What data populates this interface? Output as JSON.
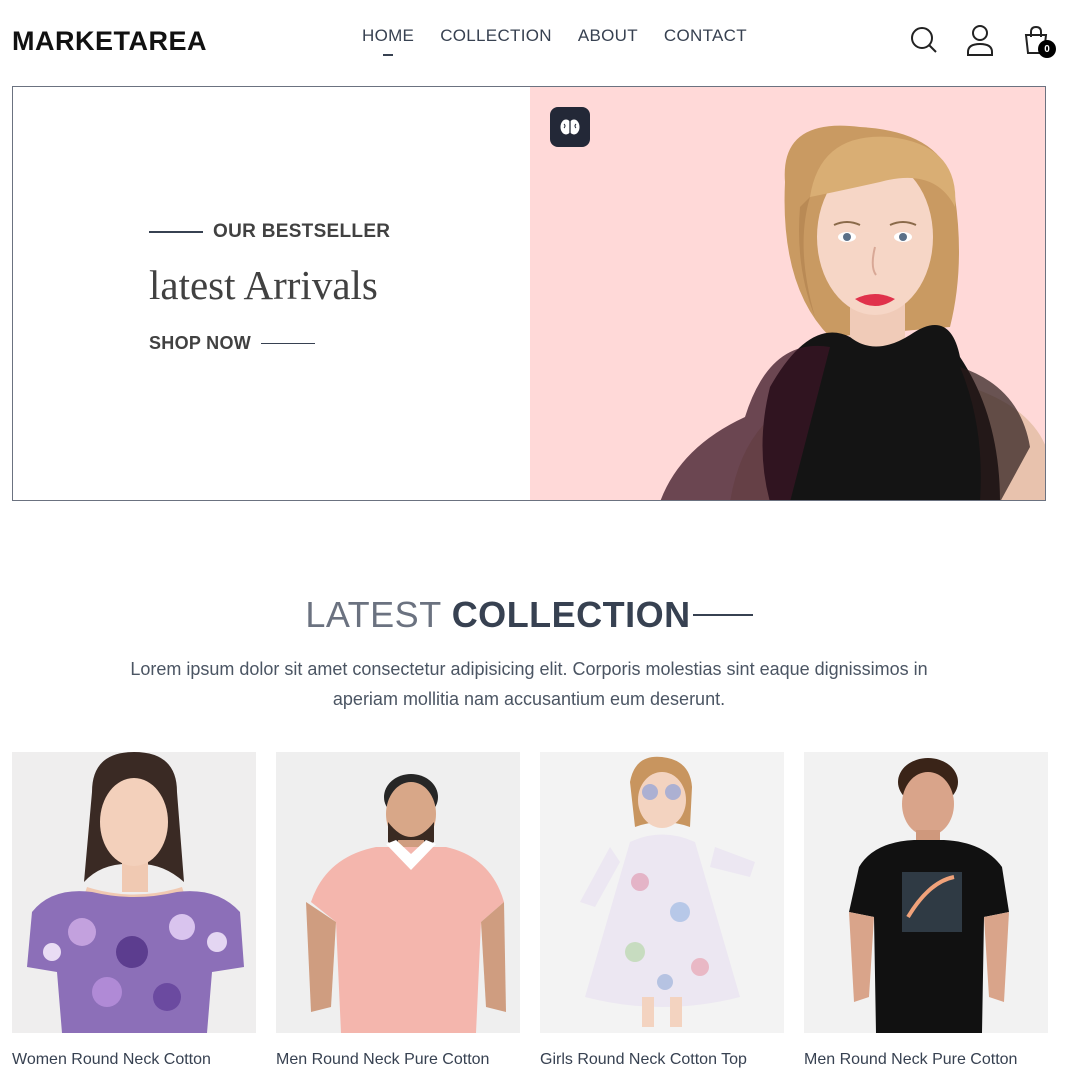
{
  "header": {
    "logo": "MARKETAREA",
    "nav": [
      {
        "label": "HOME",
        "active": true
      },
      {
        "label": "COLLECTION",
        "active": false
      },
      {
        "label": "ABOUT",
        "active": false
      },
      {
        "label": "CONTACT",
        "active": false
      }
    ],
    "icons": [
      "search-icon",
      "profile-icon",
      "cart-icon"
    ],
    "cart_count": "0"
  },
  "hero": {
    "eyebrow": "OUR BESTSELLER",
    "title": "latest Arrivals",
    "cta": "SHOP NOW",
    "badge_icon": "brain-icon",
    "background_color": "#ffd9d8"
  },
  "collection": {
    "title_light": "LATEST",
    "title_bold": "COLLECTION",
    "description": "Lorem ipsum dolor sit amet consectetur adipisicing elit. Corporis molestias sint eaque dignissimos in aperiam mollitia nam accusantium eum deserunt."
  },
  "products": [
    {
      "name": "Women Round Neck Cotton"
    },
    {
      "name": "Men Round Neck Pure Cotton"
    },
    {
      "name": "Girls Round Neck Cotton Top"
    },
    {
      "name": "Men Round Neck Pure Cotton"
    }
  ]
}
